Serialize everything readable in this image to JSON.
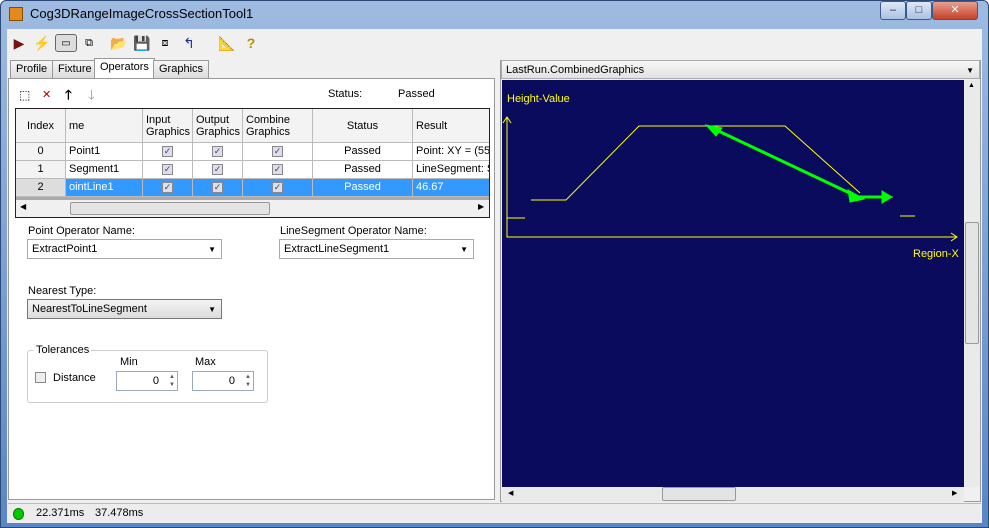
{
  "window": {
    "title": "Cog3DRangeImageCrossSectionTool1",
    "minimize": "‒",
    "maximize": "□",
    "close": "✕"
  },
  "toolbar": [
    "run-icon",
    "electric-icon",
    "show-tip-icon",
    "floating-window-icon",
    "open-icon",
    "save-icon",
    "save-settings-icon",
    "reset-icon",
    "measure-icon",
    "help-icon"
  ],
  "tabs": [
    {
      "label": "Profile"
    },
    {
      "label": "Fixture"
    },
    {
      "label": "Operators",
      "active": true
    },
    {
      "label": "Graphics"
    }
  ],
  "operators": {
    "status_label": "Status:",
    "status_value": "Passed",
    "columns": [
      "Index",
      "me",
      "Input Graphics",
      "Output Graphics",
      "Combine Graphics",
      "Status",
      "Result"
    ],
    "rows": [
      {
        "index": "0",
        "name": "Point1",
        "input": true,
        "output": true,
        "combine": true,
        "status": "Passed",
        "result": "Point: XY = (55."
      },
      {
        "index": "1",
        "name": "Segment1",
        "input": true,
        "output": true,
        "combine": true,
        "status": "Passed",
        "result": "LineSegment: S"
      },
      {
        "index": "2",
        "name": "ointLine1",
        "input": true,
        "output": true,
        "combine": true,
        "status": "Passed",
        "result": "46.67",
        "selected": true
      }
    ]
  },
  "form": {
    "point_label": "Point Operator Name:",
    "point_value": "ExtractPoint1",
    "segment_label": "LineSegment Operator Name:",
    "segment_value": "ExtractLineSegment1",
    "nearest_label": "Nearest Type:",
    "nearest_value": "NearestToLineSegment",
    "tolerances_label": "Tolerances",
    "min_label": "Min",
    "max_label": "Max",
    "distance_label": "Distance",
    "distance_checked": false,
    "min_value": "0",
    "max_value": "0"
  },
  "graphics": {
    "selector": "LastRun.CombinedGraphics",
    "y_label": "Height-Value",
    "x_label": "Region-X",
    "profile_color": "#ffff00",
    "result_color": "#00ff00",
    "background": "#0b0b5e"
  },
  "statusbar": {
    "indicator_color": "#00cc00",
    "time1": "22.371ms",
    "time2": "37.478ms"
  }
}
